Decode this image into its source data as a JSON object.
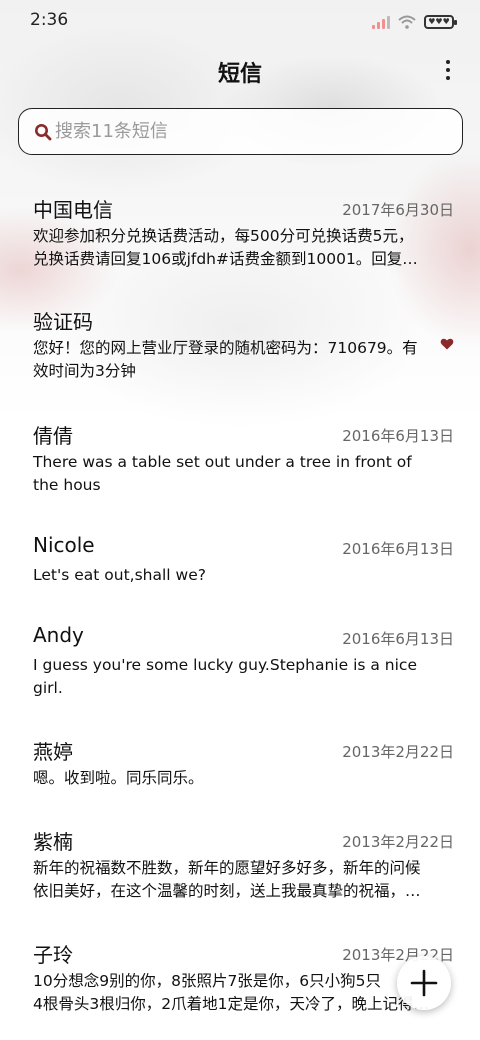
{
  "status_bar": {
    "time": "2:36",
    "battery_glyphs": "♥♥♥"
  },
  "header": {
    "title": "短信"
  },
  "search": {
    "placeholder": "搜索11条短信"
  },
  "messages": [
    {
      "sender": "中国电信",
      "date": "2017年6月30日",
      "preview": "欢迎参加积分兑换话费活动，每500分可兑换话费5元，\n兑换话费请回复106或jfdh#话费金额到10001。回复…",
      "favorite": false
    },
    {
      "sender": "验证码",
      "date": "",
      "preview": "您好！您的网上营业厅登录的随机密码为：710679。有\n效时间为3分钟",
      "favorite": true
    },
    {
      "sender": "倩倩",
      "date": "2016年6月13日",
      "preview": "There was a table set out under a tree in front of\nthe hous",
      "favorite": false
    },
    {
      "sender": "Nicole",
      "date": "2016年6月13日",
      "preview": "Let's eat out,shall we?",
      "favorite": false
    },
    {
      "sender": "Andy",
      "date": "2016年6月13日",
      "preview": "I guess you're some lucky guy.Stephanie is a nice\ngirl.",
      "favorite": false
    },
    {
      "sender": "燕婷",
      "date": "2013年2月22日",
      "preview": "嗯。收到啦。同乐同乐。",
      "favorite": false
    },
    {
      "sender": "紫楠",
      "date": "2013年2月22日",
      "preview": "新年的祝福数不胜数，新年的愿望好多好多，新年的问候\n依旧美好，在这个温馨的时刻，送上我最真挚的祝福，…",
      "favorite": false
    },
    {
      "sender": "子玲",
      "date": "2013年2月22日",
      "preview": "10分想念9别的你，8张照片7张是你，6只小狗5只\n4根骨头3根归你，2爪着地1定是你，天冷了，晚上记得…",
      "favorite": false
    }
  ],
  "colors": {
    "accent": "#8b2a2a",
    "heart": "#8b2a2a"
  },
  "icons": {
    "search": "search-icon",
    "more": "more-vert-icon",
    "fab": "plus-icon",
    "favorite": "heart-icon"
  }
}
